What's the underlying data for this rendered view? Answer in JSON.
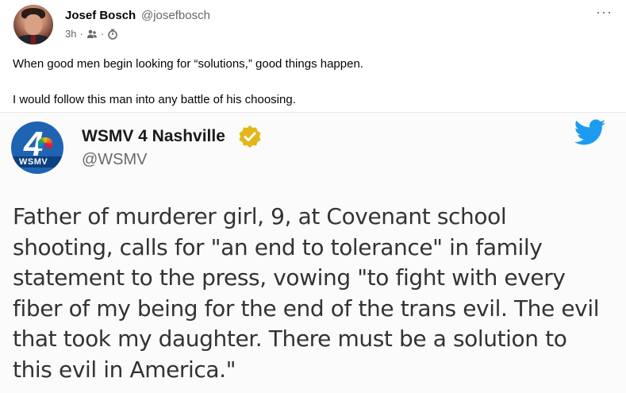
{
  "post": {
    "author_name": "Josef Bosch",
    "author_handle": "@josefbosch",
    "time": "3h",
    "separator": "·",
    "audience_icon": "friends-icon",
    "recycle_icon": "timer-icon",
    "more_label": "···",
    "text_line1": "When good men begin looking for “solutions,” good things happen.",
    "text_line2": "I would follow this man into any battle of his choosing."
  },
  "embedded_tweet": {
    "account_name": "WSMV 4 Nashville",
    "account_handle": "@WSMV",
    "logo_number": "4",
    "logo_callsign": "WSMV",
    "lines": [
      "Father of murderer girl, 9, at Covenant school",
      "shooting, calls for \"an end to tolerance\" in family",
      "statement to the press, vowing \"to fight with every",
      "fiber of my being for the end of the trans evil. The evil",
      "that took my daughter. There must be a solution to",
      "this evil in America.\""
    ]
  },
  "colors": {
    "twitter_blue": "#1d9bf0",
    "verified_gold": "#e2b719",
    "meta_gray": "#65676b"
  }
}
